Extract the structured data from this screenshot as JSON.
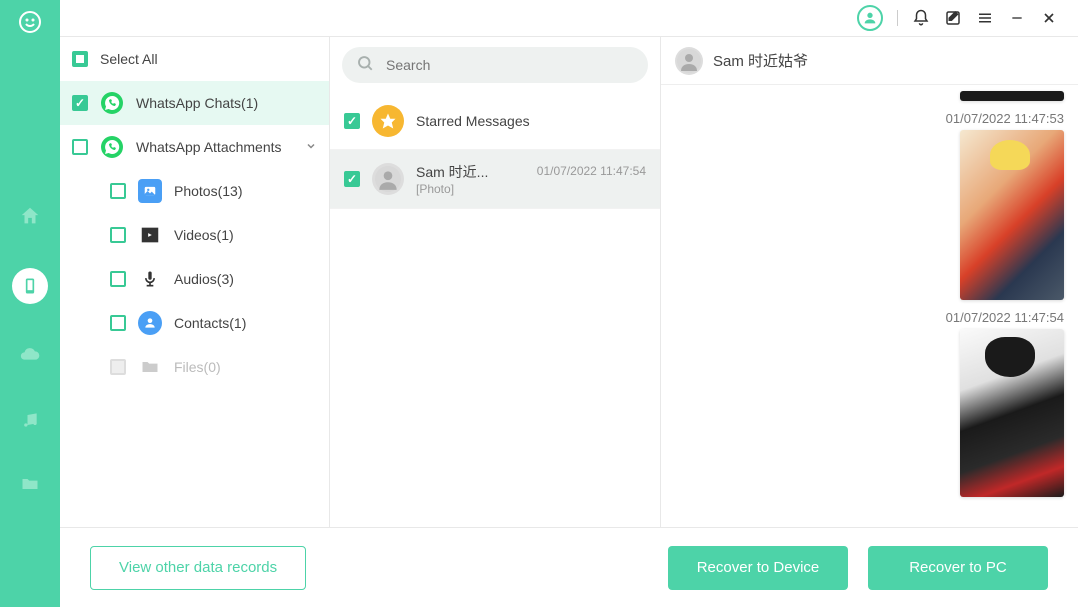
{
  "titlebar": {},
  "categories": {
    "select_all_label": "Select All",
    "whatsapp_chats_label": "WhatsApp Chats(1)",
    "whatsapp_attachments_label": "WhatsApp Attachments",
    "photos_label": "Photos(13)",
    "videos_label": "Videos(1)",
    "audios_label": "Audios(3)",
    "contacts_label": "Contacts(1)",
    "files_label": "Files(0)"
  },
  "search": {
    "placeholder": "Search"
  },
  "chats": {
    "starred_label": "Starred Messages",
    "item1_name": "Sam 时近...",
    "item1_sub": "[Photo]",
    "item1_time": "01/07/2022 11:47:54"
  },
  "messages": {
    "header_name": "Sam 时近姑爷",
    "time1": "01/07/2022 11:47:53",
    "time2": "01/07/2022 11:47:54"
  },
  "bottom": {
    "view_records_label": "View other data records",
    "recover_device_label": "Recover to Device",
    "recover_pc_label": "Recover to PC"
  },
  "colors": {
    "accent": "#4dd3a8",
    "accent_dark": "#38c995"
  }
}
